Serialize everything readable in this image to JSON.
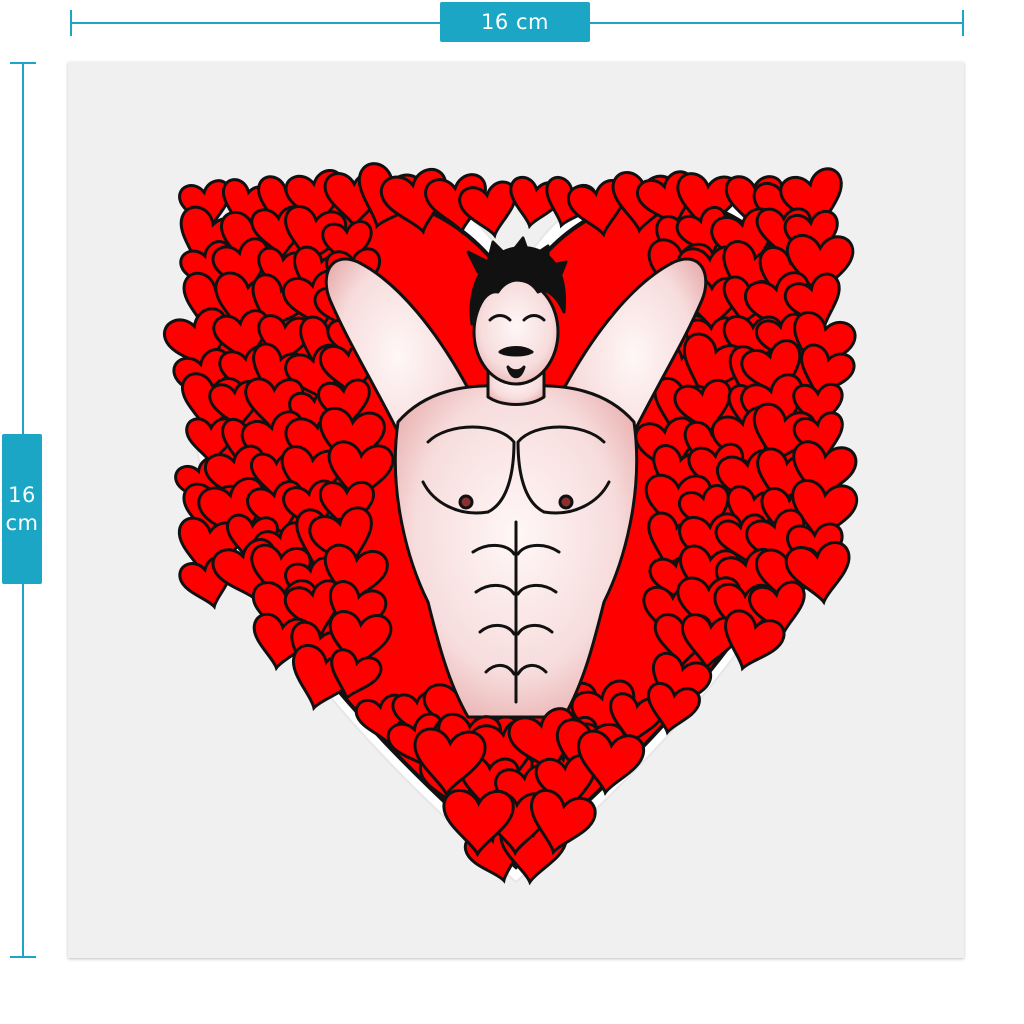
{
  "dimensions": {
    "width_label": "16 cm",
    "height_value": "16",
    "height_unit": "cm"
  },
  "colors": {
    "accent": "#1aa6c4",
    "canvas": "#f0f0f0",
    "heart_red": "#ff0000",
    "outline": "#111111",
    "skin": "#f7dede"
  },
  "artwork": {
    "subject": "heart-sticker-illustration"
  }
}
